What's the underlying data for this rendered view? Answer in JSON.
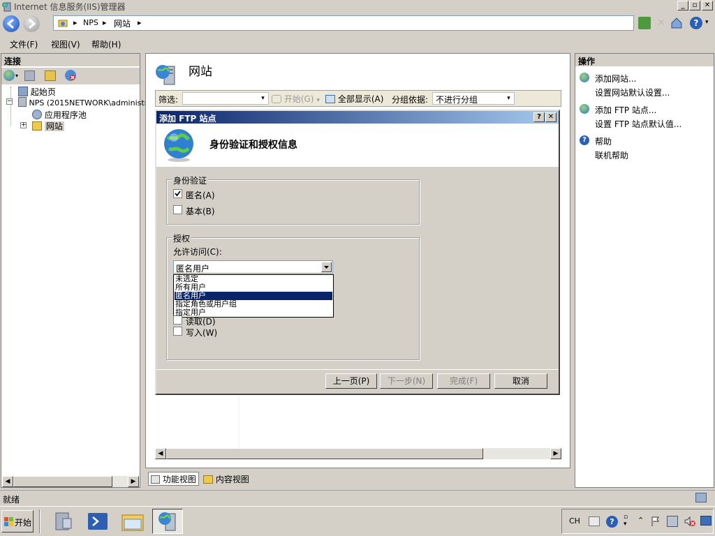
{
  "window": {
    "title": "Internet 信息服务(IIS)管理器",
    "min": "_",
    "restore": "▫",
    "close": "✕"
  },
  "address": {
    "crumbs": [
      "NPS",
      "网站"
    ]
  },
  "menu": {
    "items": [
      "文件(F)",
      "视图(V)",
      "帮助(H)"
    ]
  },
  "left": {
    "header": "连接",
    "tree": [
      {
        "label": "起始页",
        "icon": "start-page-icon"
      },
      {
        "label": "NPS (2015NETWORK\\administr",
        "icon": "server-icon"
      },
      {
        "label": "应用程序池",
        "icon": "app-pool-icon"
      },
      {
        "label": "网站",
        "icon": "sites-folder-icon"
      }
    ]
  },
  "center": {
    "title": "网站",
    "filter_label": "筛选:",
    "start_label": "开始(G)",
    "show_all_label": "全部显示(A)",
    "group_label": "分组依据:",
    "group_value": "不进行分组",
    "view_tabs": [
      "功能视图",
      "内容视图"
    ]
  },
  "right": {
    "header": "操作",
    "actions": [
      {
        "label": "添加网站...",
        "group": 1
      },
      {
        "label": "设置网站默认设置...",
        "group": 1
      },
      {
        "label": "添加 FTP 站点...",
        "group": 2
      },
      {
        "label": "设置 FTP 站点默认值...",
        "group": 2
      },
      {
        "label": "帮助",
        "group": 3
      },
      {
        "label": "联机帮助",
        "group": 3
      }
    ]
  },
  "dialog": {
    "title": "添加 FTP 站点",
    "help_btn": "?",
    "close_btn": "✕",
    "heading": "身份验证和授权信息",
    "auth_group": "身份验证",
    "auth_anonymous": "匿名(A)",
    "auth_anonymous_checked": true,
    "auth_basic": "基本(B)",
    "auth_basic_checked": false,
    "authz_group": "授权",
    "allow_access_label": "允许访问(C):",
    "allow_access_value": "匿名用户",
    "options": [
      "未选定",
      "所有用户",
      "匿名用户",
      "指定角色或用户组",
      "指定用户"
    ],
    "selected_option": 2,
    "perm_read": "读取(D)",
    "perm_write": "写入(W)",
    "btn_prev": "上一页(P)",
    "btn_next": "下一步(N)",
    "btn_finish": "完成(F)",
    "btn_cancel": "取消"
  },
  "status": {
    "text": "就绪"
  },
  "taskbar": {
    "start": "开始",
    "lang": "CH"
  }
}
